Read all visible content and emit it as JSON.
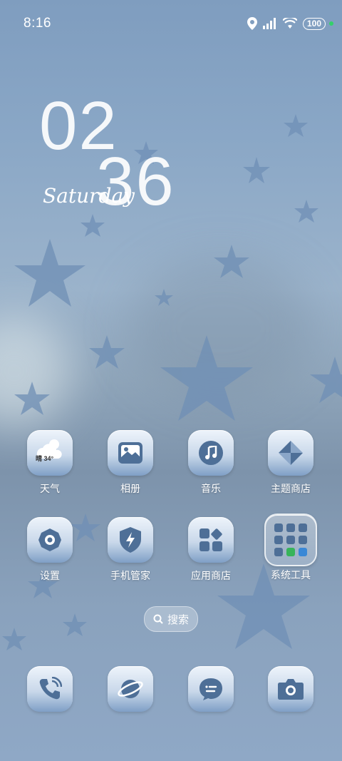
{
  "status_bar": {
    "time": "8:16",
    "battery": "100"
  },
  "clock": {
    "hours": "02",
    "minutes": "36",
    "day": "Saturday"
  },
  "weather_badge": "晴 34°",
  "apps_row1": [
    {
      "label": "天气",
      "icon": "weather-icon"
    },
    {
      "label": "相册",
      "icon": "gallery-icon"
    },
    {
      "label": "音乐",
      "icon": "music-icon"
    },
    {
      "label": "主题商店",
      "icon": "theme-store-icon"
    }
  ],
  "apps_row2": [
    {
      "label": "设置",
      "icon": "settings-icon"
    },
    {
      "label": "手机管家",
      "icon": "phone-manager-icon"
    },
    {
      "label": "应用商店",
      "icon": "app-store-icon"
    },
    {
      "label": "系统工具",
      "icon": "system-tools-folder-icon"
    }
  ],
  "search": {
    "label": "搜索"
  },
  "dock": [
    {
      "icon": "phone-icon"
    },
    {
      "icon": "browser-icon"
    },
    {
      "icon": "messages-icon"
    },
    {
      "icon": "camera-icon"
    }
  ],
  "colors": {
    "icon_blue": "#4e6f97",
    "battery_indicator": "#33d16a"
  }
}
